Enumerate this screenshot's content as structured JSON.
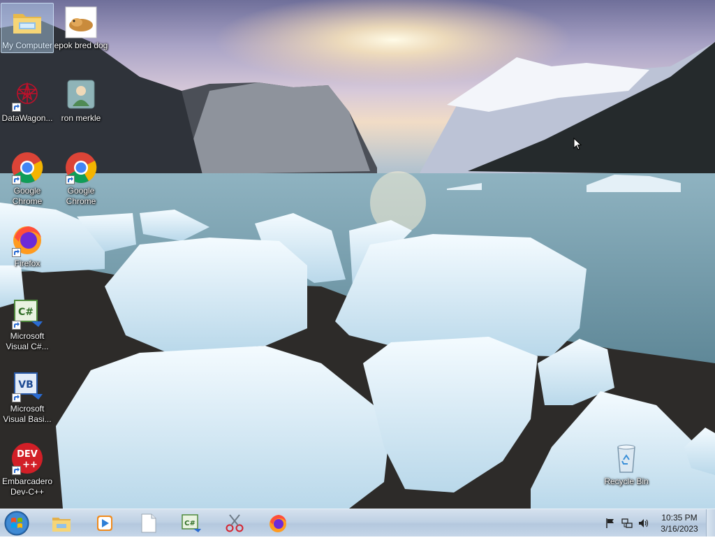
{
  "desktop": {
    "icons": [
      {
        "label": "My Computer",
        "icon": "folder-icon"
      },
      {
        "label": "epok bred dog",
        "icon": "dog-image-icon"
      },
      {
        "label": "DataWagon...",
        "icon": "datawagon-icon"
      },
      {
        "label": "ron merkle",
        "icon": "user-icon"
      },
      {
        "label": "Google Chrome",
        "icon": "chrome-icon"
      },
      {
        "label": "Google Chrome",
        "icon": "chrome-icon"
      },
      {
        "label": "Firefox",
        "icon": "firefox-icon"
      },
      {
        "label": "Microsoft Visual C#...",
        "icon": "visual-csharp-icon"
      },
      {
        "label": "Microsoft Visual Basi...",
        "icon": "visual-basic-icon"
      },
      {
        "label": "Embarcadero Dev-C++",
        "icon": "devcpp-icon"
      },
      {
        "label": "Recycle Bin",
        "icon": "recycle-bin-icon"
      }
    ],
    "devcpp_badge_top": "DEV",
    "devcpp_badge_bottom": "++",
    "csharp_badge": "C#",
    "vb_badge": "VB"
  },
  "taskbar": {
    "start_icon": "windows-logo-icon",
    "pinned": [
      {
        "name": "File Explorer",
        "icon": "folder-icon"
      },
      {
        "name": "Windows Media Player",
        "icon": "media-player-icon"
      },
      {
        "name": "Blank document",
        "icon": "document-icon"
      },
      {
        "name": "Visual C#",
        "icon": "visual-csharp-icon"
      },
      {
        "name": "Snipping Tool",
        "icon": "scissors-icon"
      },
      {
        "name": "Firefox",
        "icon": "firefox-icon"
      }
    ],
    "tray": [
      "flag-icon",
      "network-icon",
      "speaker-icon"
    ],
    "time": "10:35 PM",
    "date": "3/16/2023"
  }
}
